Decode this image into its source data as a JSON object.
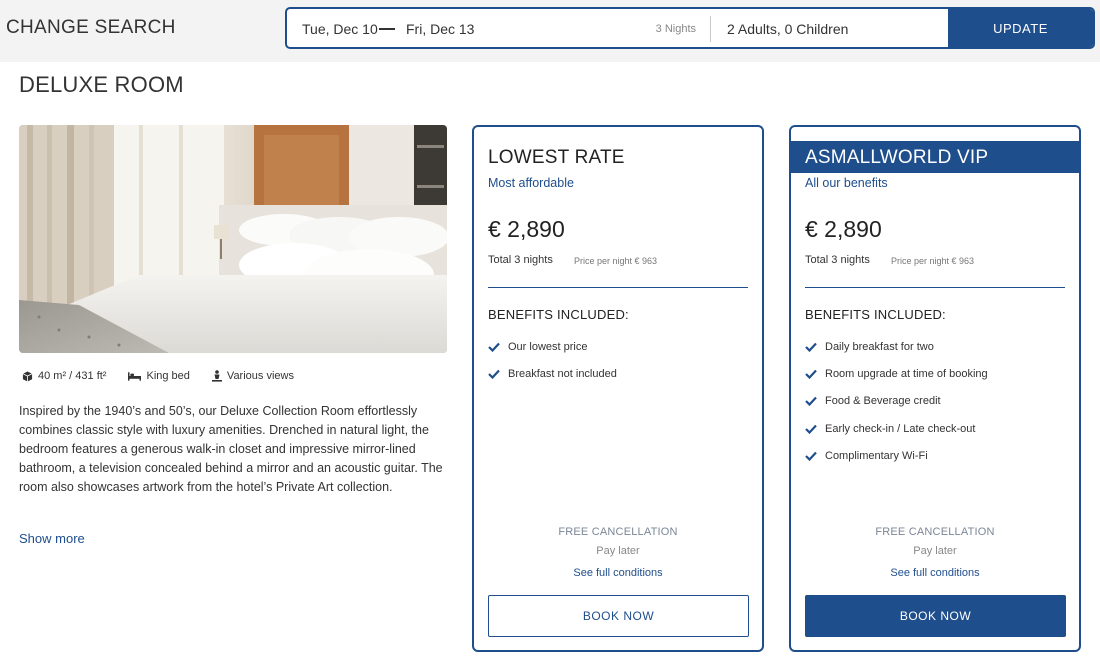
{
  "search": {
    "change_label": "CHANGE SEARCH",
    "date_from": "Tue, Dec 10",
    "date_to": "Fri, Dec 13",
    "nights": "3 Nights",
    "guests": "2 Adults, 0 Children",
    "update_label": "UPDATE"
  },
  "room": {
    "title": "DELUXE ROOM",
    "features": [
      {
        "icon": "cube-icon",
        "label": "40 m² / 431 ft²"
      },
      {
        "icon": "bed-icon",
        "label": "King bed"
      },
      {
        "icon": "view-icon",
        "label": "Various views"
      }
    ],
    "description": "Inspired by the 1940’s and 50’s, our Deluxe Collection Room effortlessly combines classic style with luxury amenities. Drenched in natural light, the bedroom features a generous walk-in closet and impressive mirror-lined bathroom, a television concealed behind a mirror and an acoustic guitar. The room also showcases artwork from the hotel’s Private Art collection.",
    "show_more": "Show more"
  },
  "rates": [
    {
      "title": "LOWEST RATE",
      "subtitle": "Most affordable",
      "price": "€ 2,890",
      "total": "Total 3 nights",
      "per_night": "Price per night € 963",
      "benefits_heading": "BENEFITS INCLUDED:",
      "benefits": [
        "Our lowest price",
        "Breakfast not included"
      ],
      "cancellation": "FREE CANCELLATION",
      "pay_later": "Pay later",
      "conditions": "See full conditions",
      "book_label": "BOOK NOW"
    },
    {
      "title": "ASMALLWORLD VIP",
      "subtitle": "All our benefits",
      "price": "€ 2,890",
      "total": "Total 3 nights",
      "per_night": "Price per night € 963",
      "benefits_heading": "BENEFITS INCLUDED:",
      "benefits": [
        "Daily breakfast for two",
        "Room upgrade at time of booking",
        "Food & Beverage credit",
        "Early check-in / Late check-out",
        "Complimentary Wi-Fi"
      ],
      "cancellation": "FREE CANCELLATION",
      "pay_later": "Pay later",
      "conditions": "See full conditions",
      "book_label": "BOOK NOW"
    }
  ],
  "colors": {
    "brand": "#1f4e8c",
    "text": "#2b2b2b",
    "muted": "#7a8797"
  }
}
